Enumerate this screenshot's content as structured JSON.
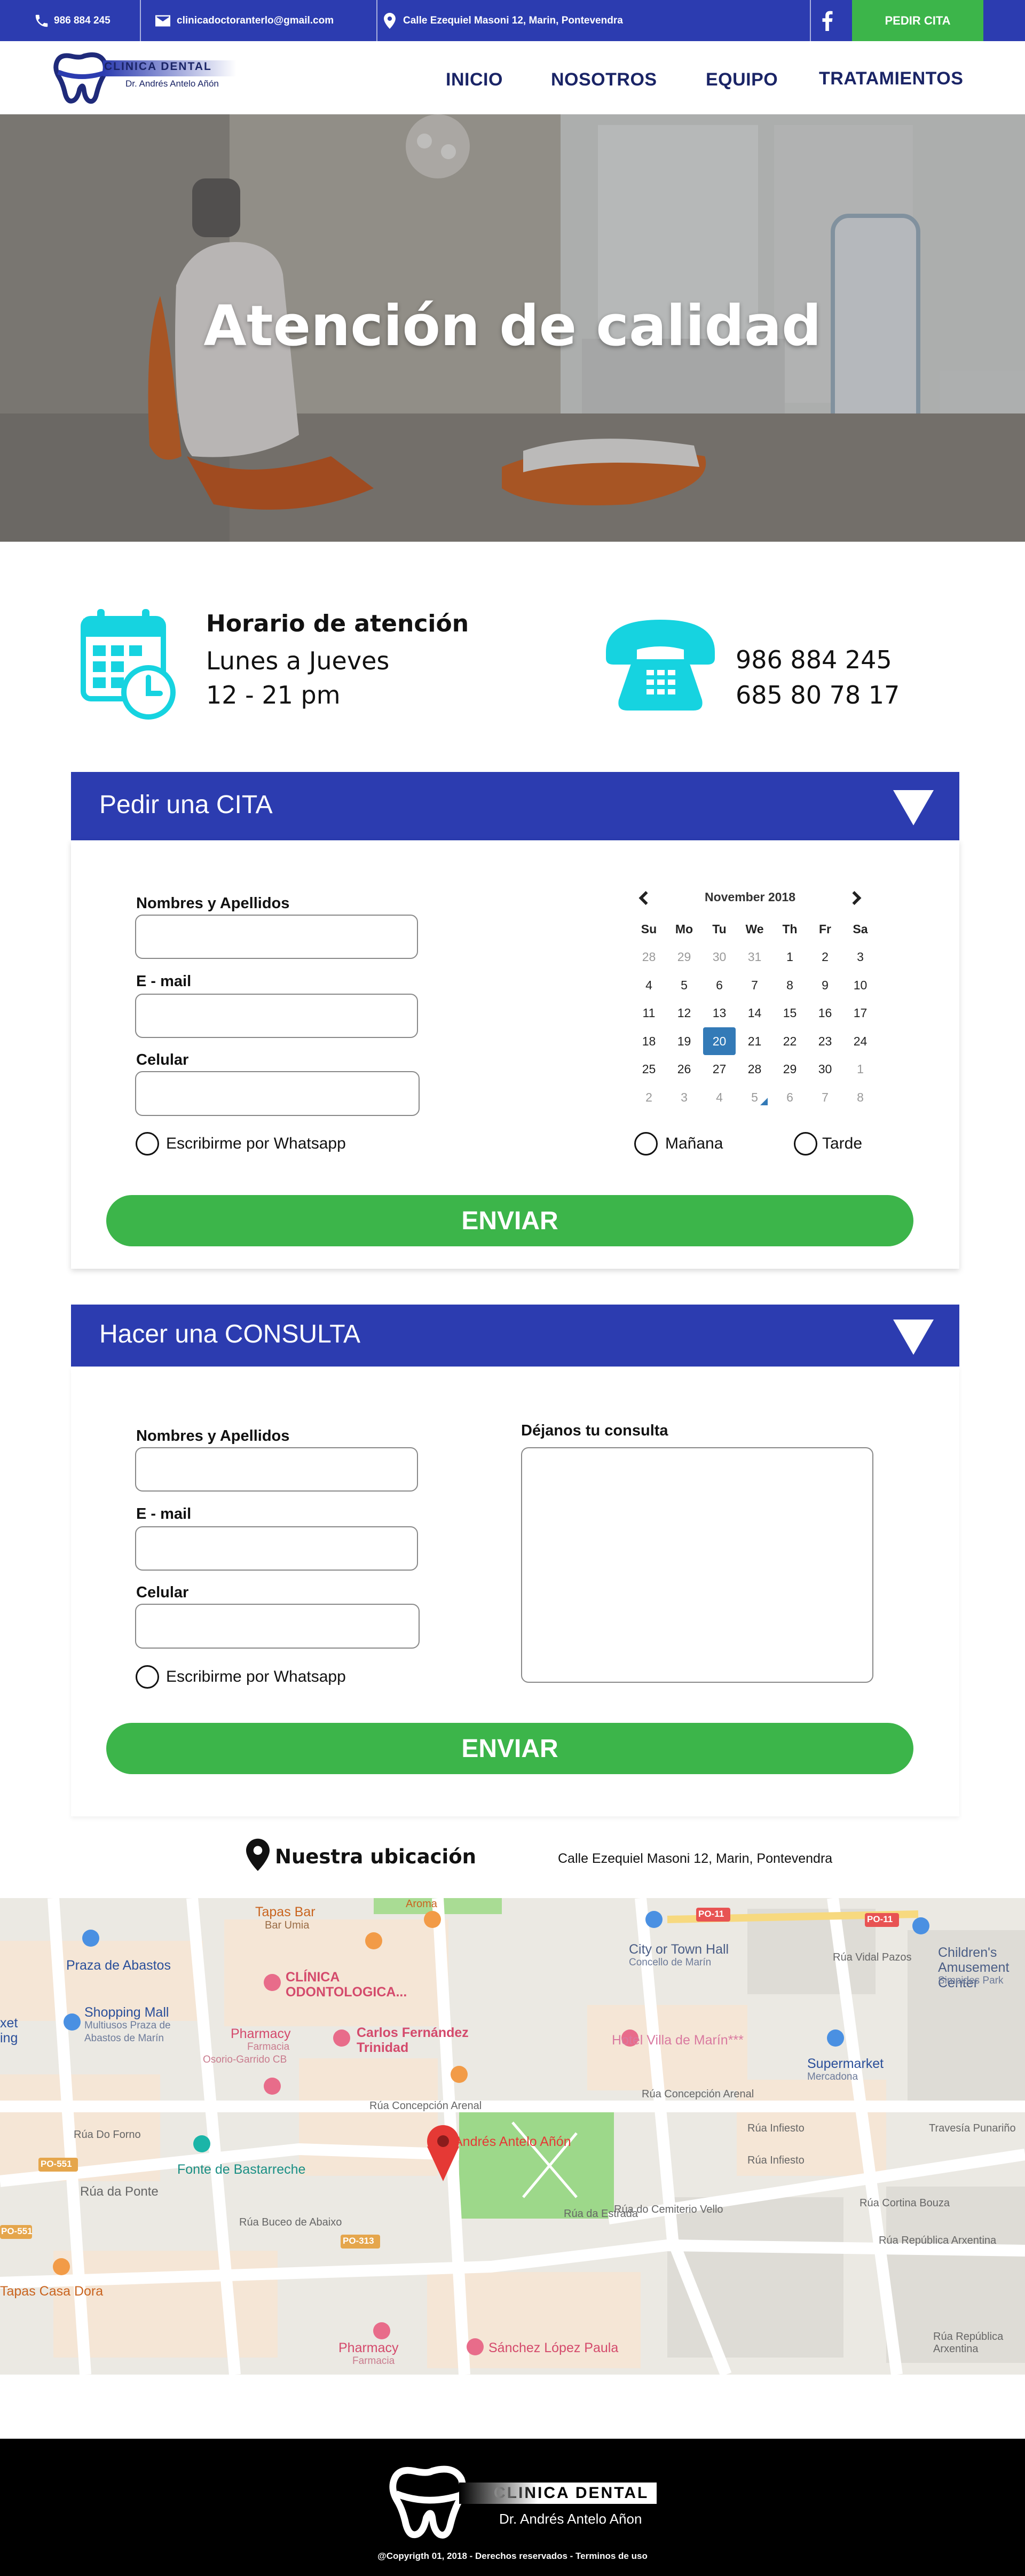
{
  "topbar": {
    "phone": "986 884 245",
    "email": "clinicadoctoranterlo@gmail.com",
    "address": "Calle Ezequiel Masoni 12, Marin, Pontevendra",
    "cta": "PEDIR CITA"
  },
  "logo": {
    "name": "CLINICA DENTAL",
    "doctor": "Dr. Andrés Antelo Añón"
  },
  "nav": {
    "items": [
      "INICIO",
      "NOSOTROS",
      "EQUIPO",
      "TRATAMIENTOS"
    ]
  },
  "hero": {
    "title": "Atención de calidad"
  },
  "info": {
    "schedule_title": "Horario de atención",
    "schedule_days": "Lunes a Jueves",
    "schedule_hours": "12 - 21 pm",
    "phone_1": "986 884 245",
    "phone_2": "685 80 78 17"
  },
  "cita": {
    "title": "Pedir una CITA",
    "labels": {
      "name": "Nombres y Apellidos",
      "email": "E - mail",
      "phone": "Celular"
    },
    "whatsapp": "Escribirme por Whatsapp",
    "morning": "Mañana",
    "afternoon": "Tarde",
    "submit": "ENVIAR",
    "calendar": {
      "month": "November 2018",
      "weekdays": [
        "Su",
        "Mo",
        "Tu",
        "We",
        "Th",
        "Fr",
        "Sa"
      ],
      "weeks": [
        [
          "28",
          "29",
          "30",
          "31",
          "1",
          "2",
          "3"
        ],
        [
          "4",
          "5",
          "6",
          "7",
          "8",
          "9",
          "10"
        ],
        [
          "11",
          "12",
          "13",
          "14",
          "15",
          "16",
          "17"
        ],
        [
          "18",
          "19",
          "20",
          "21",
          "22",
          "23",
          "24"
        ],
        [
          "25",
          "26",
          "27",
          "28",
          "29",
          "30",
          "1"
        ],
        [
          "2",
          "3",
          "4",
          "5",
          "6",
          "7",
          "8"
        ]
      ],
      "selected_day": "20"
    }
  },
  "consulta": {
    "title": "Hacer una CONSULTA",
    "labels": {
      "name": "Nombres y Apellidos",
      "email": "E - mail",
      "phone": "Celular",
      "message": "Déjanos tu consulta"
    },
    "whatsapp": "Escribirme por Whatsapp",
    "submit": "ENVIAR"
  },
  "location": {
    "title": "Nuestra ubicación",
    "address": "Calle Ezequiel Masoni 12, Marin, Pontevendra"
  },
  "map": {
    "labels": [
      "Tapas Bar",
      "Bar Umia",
      "Praza de Abastos",
      "CLÍNICA",
      "ODONTOLOGICA...",
      "Shopping Mall",
      "Multiusos Praza de",
      "Abastos de Marín",
      "Pharmacy",
      "Farmacia",
      "Osorio-Garrido CB",
      "Carlos Fernández",
      "Trinidad",
      "City or Town Hall",
      "Concello de Marín",
      "Hotel Villa de Marín***",
      "Children's",
      "Amusement Center",
      "Simpides Park",
      "Supermarket",
      "Mercadona",
      "Rúa Concepción Arenal",
      "Rúa Concepción Arenal",
      "Rúa Do Forno",
      "Fonte de Bastarreche",
      "Rúa da Ponte",
      "Rúa Buceo de Abaixo",
      "Andrés Antelo Añón",
      "Rúa do Cemiterio Vello",
      "Rúa da Estrada",
      "Rúa Vidal Pazos",
      "Rúa Infiesto",
      "Travesía Punariño",
      "Rúa Cortina Bouza",
      "Rúa República Arxentina",
      "Rúa República Arxentina",
      "Tapas Casa Dora",
      "Pharmacy",
      "Farmacia",
      "Sánchez López Paula",
      "PO-551",
      "PO-551",
      "PO-313",
      "PO-11",
      "PO-11",
      "xet",
      "ing",
      "Aroma",
      "Rúa Infiesto"
    ]
  },
  "footer": {
    "name": "CLINICA DENTAL",
    "doctor": "Dr. Andrés Antelo Añon",
    "copyright": "@Copyrigth 01, 2018 - Derechos reservados - Terminos de uso"
  },
  "colors": {
    "primary_blue": "#2c3cb0",
    "green": "#3cb54a",
    "cyan_icons": "#16d3e0",
    "selected_day": "#337ab7"
  }
}
